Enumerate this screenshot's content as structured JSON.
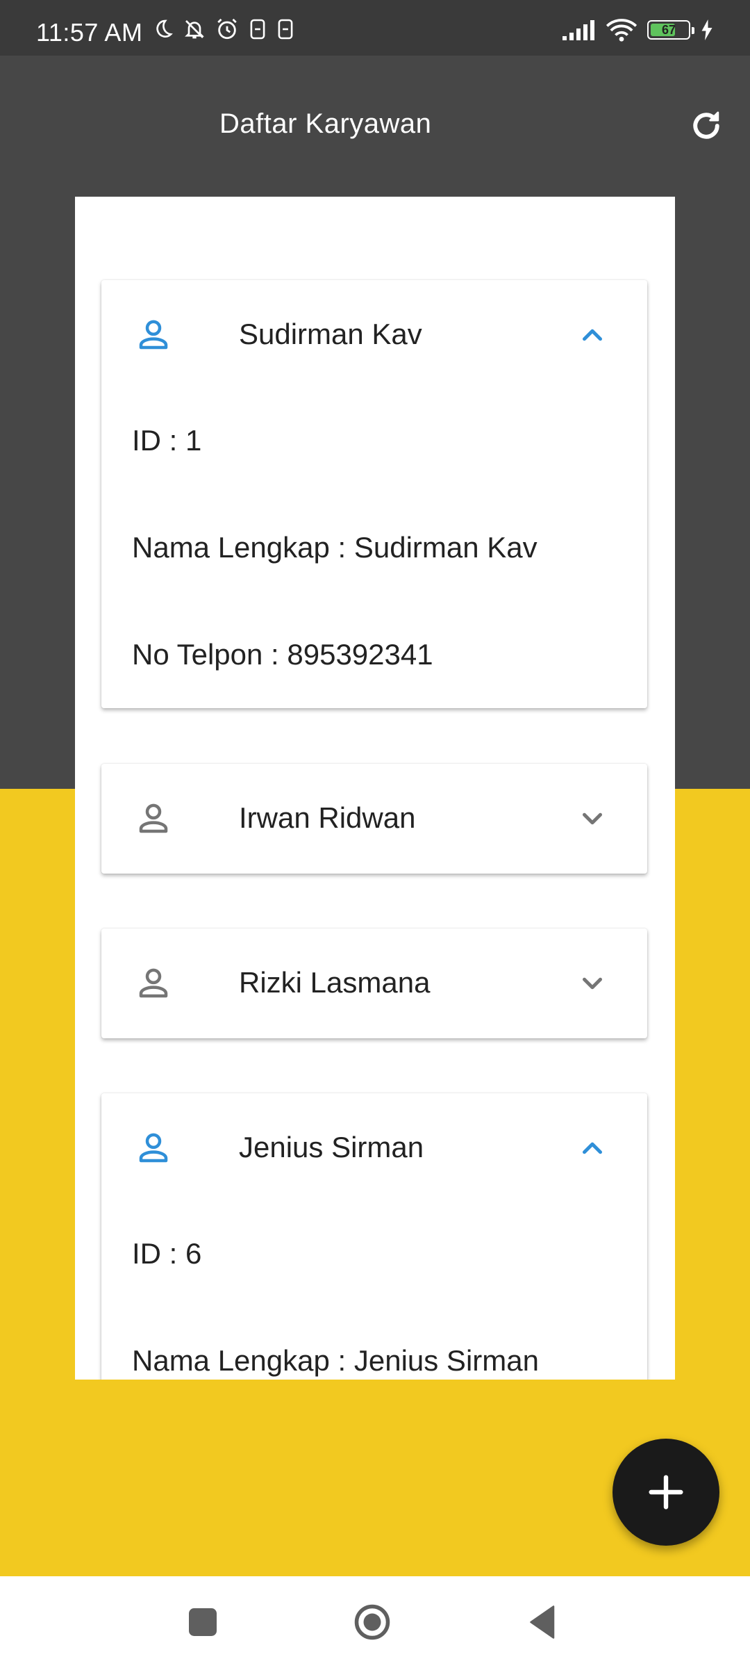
{
  "status_bar": {
    "time": "11:57 AM",
    "battery_percent": "67",
    "battery_level": 0.67,
    "icons": [
      "moon-icon",
      "bell-off-icon",
      "alarm-icon",
      "sim-icon",
      "sim-icon",
      "signal-icon",
      "wifi-icon",
      "battery-icon",
      "charging-icon"
    ]
  },
  "app_bar": {
    "title": "Daftar Karyawan",
    "refresh_icon": "refresh-icon"
  },
  "employees": [
    {
      "name": "Sudirman Kav",
      "expanded": true,
      "id_line": "ID : 1",
      "name_line": "Nama Lengkap : Sudirman Kav",
      "phone_line": "No Telpon : 895392341"
    },
    {
      "name": "Irwan Ridwan",
      "expanded": false
    },
    {
      "name": "Rizki Lasmana",
      "expanded": false
    },
    {
      "name": "Jenius Sirman",
      "expanded": true,
      "id_line": "ID : 6",
      "name_line": "Nama Lengkap : Jenius Sirman"
    }
  ],
  "fab": {
    "icon": "plus-icon"
  },
  "nav_bar": {
    "icons": [
      "recents-icon",
      "home-icon",
      "back-icon"
    ]
  },
  "colors": {
    "accent_blue": "#2f8fd8",
    "yellow_bg": "#f2c920",
    "dark_header": "#474747",
    "icon_gray": "#757575"
  }
}
